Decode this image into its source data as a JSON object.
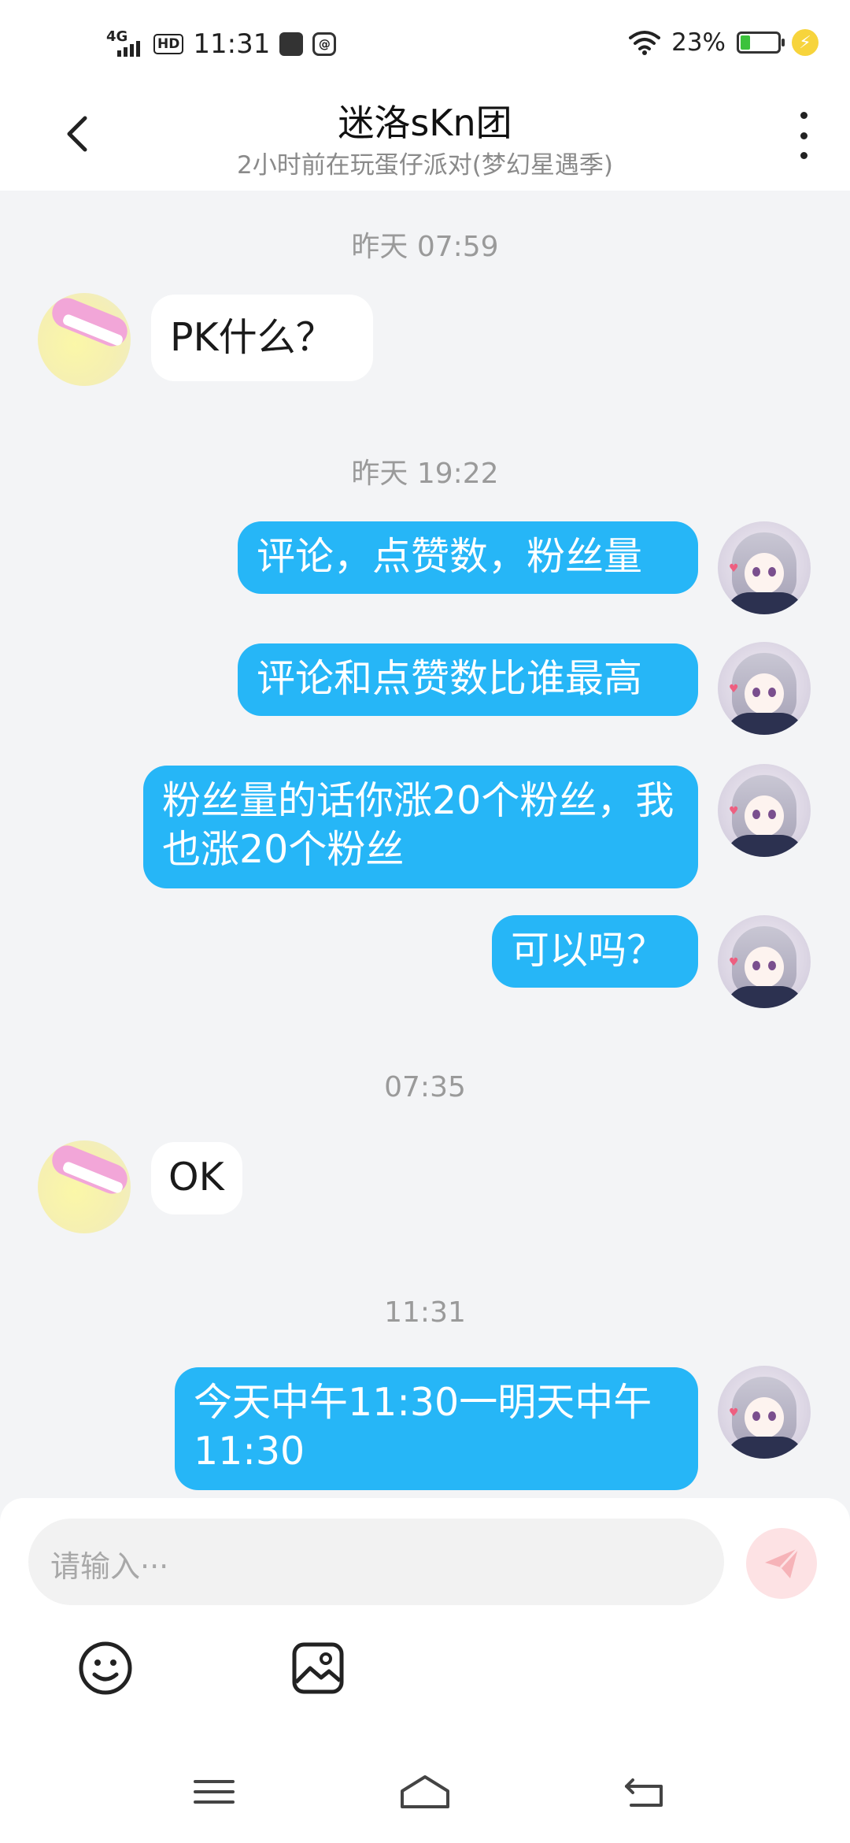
{
  "status_bar": {
    "network": "4G",
    "hd_label": "HD",
    "time": "11:31",
    "battery_percent": "23%",
    "battery_level": 0.23
  },
  "header": {
    "title": "迷洛sKn团",
    "subtitle": "2小时前在玩蛋仔派对(梦幻星遇季)"
  },
  "messages": [
    {
      "type": "timestamp",
      "text": "昨天 07:59"
    },
    {
      "type": "incoming",
      "text": "PK什么？"
    },
    {
      "type": "timestamp",
      "text": "昨天 19:22"
    },
    {
      "type": "outgoing",
      "text": "评论，点赞数，粉丝量"
    },
    {
      "type": "outgoing",
      "text": "评论和点赞数比谁最高"
    },
    {
      "type": "outgoing",
      "text": "粉丝量的话你涨20个粉丝，我也涨20个粉丝"
    },
    {
      "type": "outgoing",
      "text": "可以吗？"
    },
    {
      "type": "timestamp",
      "text": "07:35"
    },
    {
      "type": "incoming",
      "text": "OK"
    },
    {
      "type": "timestamp",
      "text": "11:31"
    },
    {
      "type": "outgoing",
      "text": "今天中午11:30一明天中午11:30"
    }
  ],
  "composer": {
    "placeholder": "请输入···"
  },
  "icons": {
    "back": "chevron-left-icon",
    "more": "more-vertical-icon",
    "send": "send-icon",
    "emoji": "emoji-icon",
    "image": "image-icon",
    "nav_menu": "menu-icon",
    "nav_home": "home-icon",
    "nav_back": "back-nav-icon"
  },
  "colors": {
    "outgoing_bubble": "#26b6f7",
    "incoming_bubble": "#ffffff",
    "background": "#f3f4f6",
    "send_disabled": "#fde2e4"
  }
}
